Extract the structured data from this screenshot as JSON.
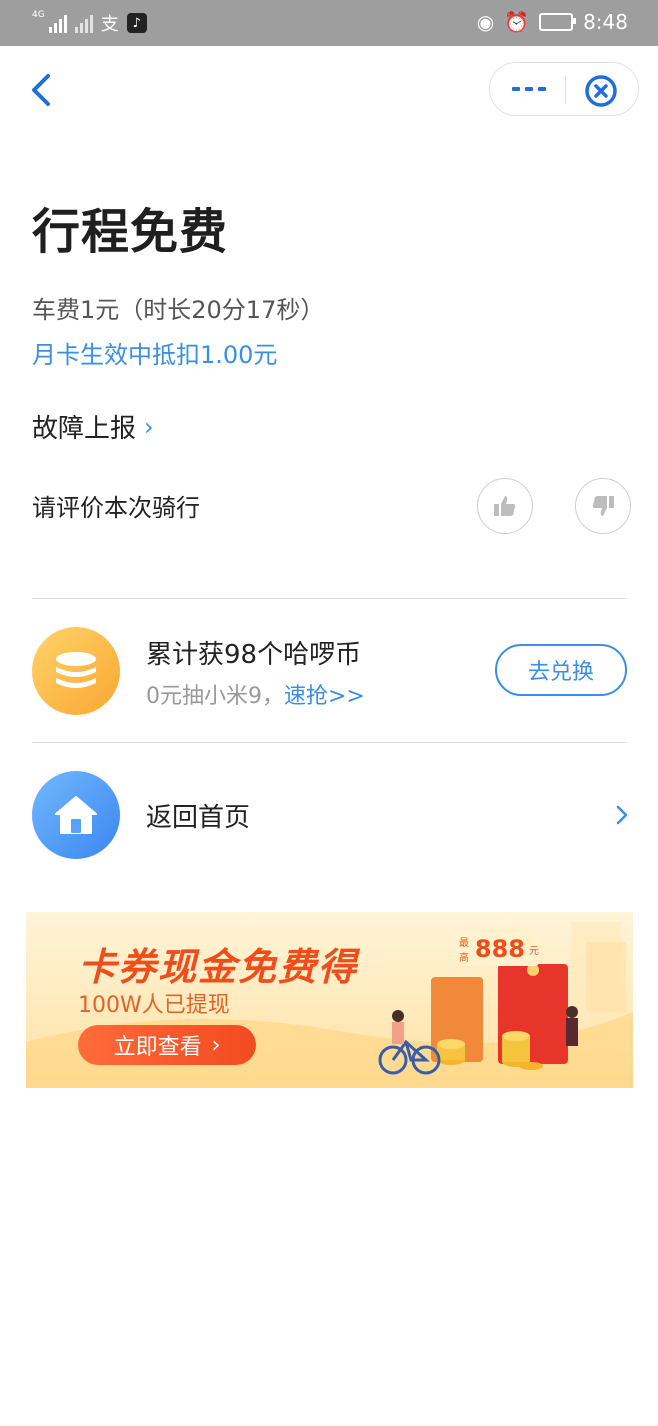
{
  "status_bar": {
    "network_tag": "4G",
    "alipay_glyph": "支",
    "time": "8:48"
  },
  "header": {
    "back_icon": "chevron-left-icon",
    "more_icon": "more-dots-icon",
    "close_icon": "close-circle-icon"
  },
  "trip": {
    "title": "行程免费",
    "fare_line": "车费1元（时长20分17秒）",
    "monthly_card_line": "月卡生效中抵扣1.00元"
  },
  "report": {
    "label": "故障上报",
    "chevron": "›"
  },
  "rating": {
    "prompt": "请评价本次骑行"
  },
  "coins": {
    "title": "累计获98个哈啰币",
    "sub_prefix": "0元抽小米9，",
    "sub_link": "速抢>>",
    "button_label": "去兑换"
  },
  "home": {
    "label": "返回首页"
  },
  "banner": {
    "title": "卡券现金免费得",
    "subtitle": "100W人已提现",
    "button_label": "立即查看",
    "button_arrow": "›",
    "badge_small": "最高",
    "badge_amount": "888",
    "badge_unit": "元"
  },
  "colors": {
    "accent": "#3a8ee6",
    "banner_orange": "#f04d1c",
    "coin_gold": "#f9a631"
  }
}
